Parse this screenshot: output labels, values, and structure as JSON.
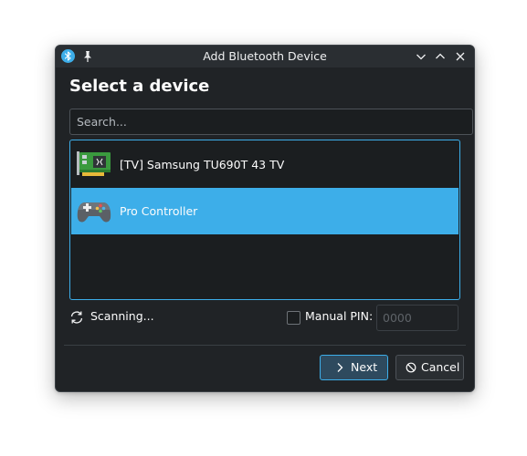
{
  "window": {
    "title": "Add Bluetooth Device",
    "titlebar_icons": [
      "bluetooth-icon",
      "pin-icon"
    ],
    "controls": [
      "minimize-icon",
      "maximize-icon",
      "close-icon"
    ]
  },
  "heading": "Select a device",
  "search": {
    "placeholder": "Search...",
    "value": ""
  },
  "devices": [
    {
      "label": "[TV] Samsung TU690T 43 TV",
      "icon": "network-card-icon",
      "selected": false
    },
    {
      "label": "Pro Controller",
      "icon": "gamepad-icon",
      "selected": true
    }
  ],
  "status": {
    "icon": "refresh-icon",
    "text": "Scanning..."
  },
  "manual_pin": {
    "label": "Manual PIN:",
    "checked": false,
    "placeholder": "0000",
    "value": ""
  },
  "buttons": {
    "next": "Next",
    "cancel": "Cancel"
  },
  "colors": {
    "accent": "#3daee9",
    "window_bg": "#202326",
    "titlebar_bg": "#2a2e32",
    "field_bg": "#1b1e20",
    "text": "#fcfcfc"
  }
}
